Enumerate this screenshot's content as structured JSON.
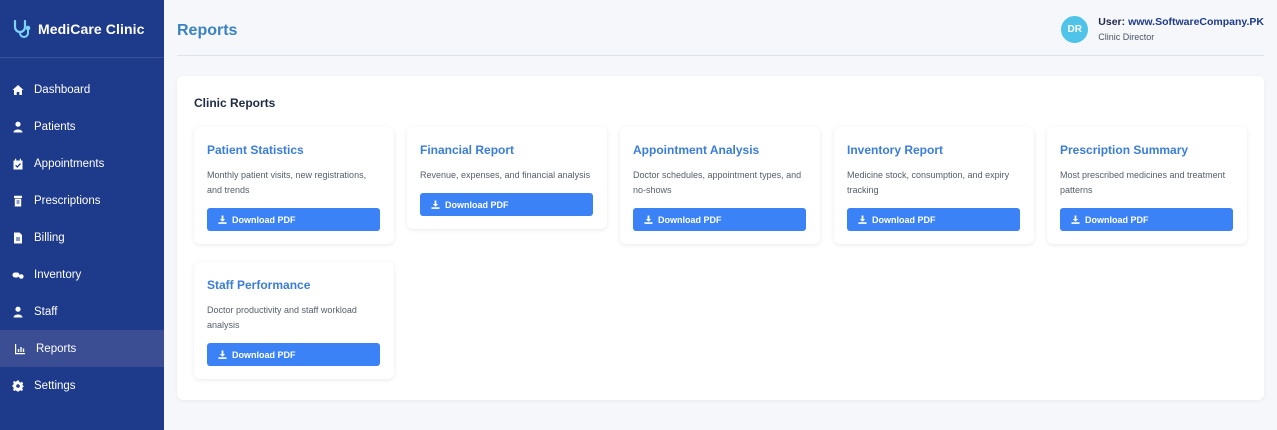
{
  "app": {
    "name": "MediCare Clinic"
  },
  "sidebar": {
    "items": [
      {
        "label": "Dashboard",
        "icon": "home-icon",
        "active": false
      },
      {
        "label": "Patients",
        "icon": "user-icon",
        "active": false
      },
      {
        "label": "Appointments",
        "icon": "calendar-check-icon",
        "active": false
      },
      {
        "label": "Prescriptions",
        "icon": "prescription-bottle-icon",
        "active": false
      },
      {
        "label": "Billing",
        "icon": "invoice-icon",
        "active": false
      },
      {
        "label": "Inventory",
        "icon": "pills-icon",
        "active": false
      },
      {
        "label": "Staff",
        "icon": "user-tie-icon",
        "active": false
      },
      {
        "label": "Reports",
        "icon": "chart-icon",
        "active": true
      },
      {
        "label": "Settings",
        "icon": "gear-icon",
        "active": false
      }
    ]
  },
  "header": {
    "title": "Reports",
    "user": {
      "initials": "DR",
      "prefix": "User:",
      "name": "www.SoftwareCompany.PK",
      "role": "Clinic Director"
    }
  },
  "main": {
    "section_title": "Clinic Reports",
    "reports": [
      {
        "title": "Patient Statistics",
        "description": "Monthly patient visits, new registrations, and trends",
        "button": "Download PDF"
      },
      {
        "title": "Financial Report",
        "description": "Revenue, expenses, and financial analysis",
        "button": "Download PDF"
      },
      {
        "title": "Appointment Analysis",
        "description": "Doctor schedules, appointment types, and no-shows",
        "button": "Download PDF"
      },
      {
        "title": "Inventory Report",
        "description": "Medicine stock, consumption, and expiry tracking",
        "button": "Download PDF"
      },
      {
        "title": "Prescription Summary",
        "description": "Most prescribed medicines and treatment patterns",
        "button": "Download PDF"
      },
      {
        "title": "Staff Performance",
        "description": "Doctor productivity and staff workload analysis",
        "button": "Download PDF"
      }
    ]
  },
  "colors": {
    "sidebar": "#1e3a8a",
    "accent": "#3b82f6",
    "title": "#3b82c4",
    "avatar": "#4fc3e8"
  }
}
